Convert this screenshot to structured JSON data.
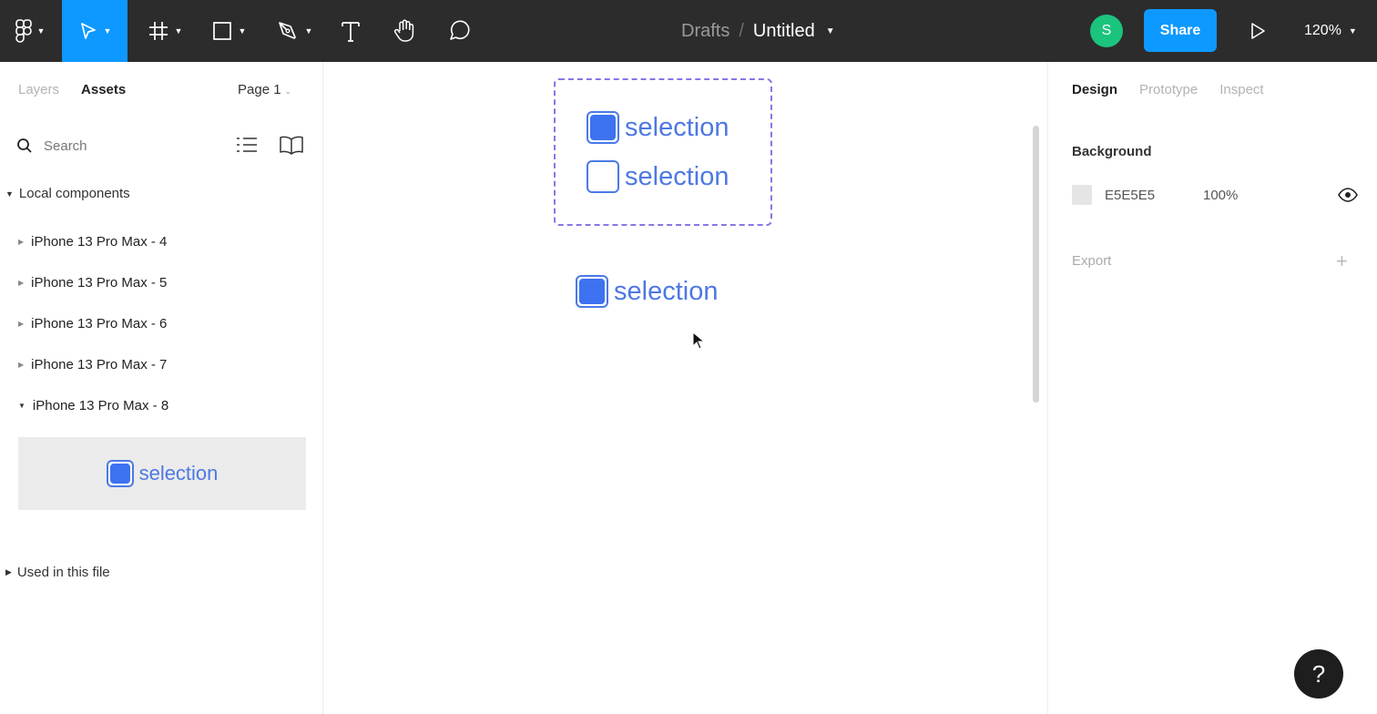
{
  "toolbar": {
    "breadcrumb": "Drafts",
    "separator": "/",
    "file_name": "Untitled",
    "avatar_initial": "S",
    "share_label": "Share",
    "zoom_level": "120%",
    "accent": "#0d99ff"
  },
  "left_panel": {
    "tabs": [
      {
        "label": "Layers",
        "active": false
      },
      {
        "label": "Assets",
        "active": true
      }
    ],
    "page_selector": "Page 1",
    "search_placeholder": "Search",
    "local_components_label": "Local components",
    "components": [
      {
        "label": "iPhone 13 Pro Max - 4",
        "expanded": false
      },
      {
        "label": "iPhone 13 Pro Max - 5",
        "expanded": false
      },
      {
        "label": "iPhone 13 Pro Max - 6",
        "expanded": false
      },
      {
        "label": "iPhone 13 Pro Max - 7",
        "expanded": false
      },
      {
        "label": "iPhone 13 Pro Max - 8",
        "expanded": true
      }
    ],
    "preview_label": "selection",
    "used_in_file_label": "Used in this file"
  },
  "canvas": {
    "variant_items": [
      {
        "label": "selection",
        "checked": true
      },
      {
        "label": "selection",
        "checked": false
      }
    ],
    "instance": {
      "label": "selection",
      "checked": true
    }
  },
  "right_panel": {
    "tabs": [
      {
        "label": "Design",
        "active": true
      },
      {
        "label": "Prototype",
        "active": false
      },
      {
        "label": "Inspect",
        "active": false
      }
    ],
    "background_label": "Background",
    "background_hex": "E5E5E5",
    "background_opacity": "100%",
    "background_color": "#e5e5e5",
    "export_label": "Export"
  },
  "help_label": "?"
}
